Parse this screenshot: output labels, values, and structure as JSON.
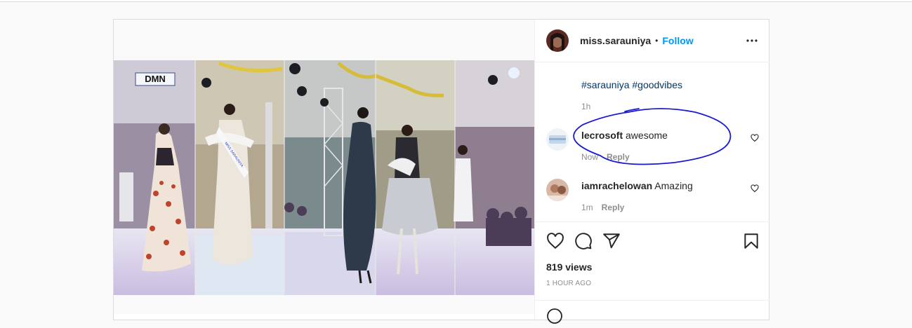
{
  "post": {
    "username": "miss.sarauniya",
    "separator": "•",
    "follow_label": "Follow",
    "more_label": "•••",
    "caption": {
      "tags": "#sarauniya #goodvibes",
      "time": "1h"
    },
    "media": {
      "watermark": "DMN",
      "sash_text": "MISS SARAUNIYA"
    },
    "comments": [
      {
        "user": "lecrosoft",
        "text": "awesome",
        "time": "Now",
        "reply_label": "Reply"
      },
      {
        "user": "iamrachelowan",
        "text": "Amazing",
        "time": "1m",
        "reply_label": "Reply"
      }
    ],
    "views": "819 views",
    "posted_ago": "1 HOUR AGO",
    "icons": {
      "like": "heart-icon",
      "comment": "comment-icon",
      "share": "share-icon",
      "save": "bookmark-icon",
      "more": "more-icon",
      "annotation": "hand-drawn-ellipse"
    },
    "colors": {
      "link": "#0095f6",
      "hashtag": "#00376b",
      "muted": "#8e8e8e",
      "annotation": "#1a1ad6"
    }
  }
}
